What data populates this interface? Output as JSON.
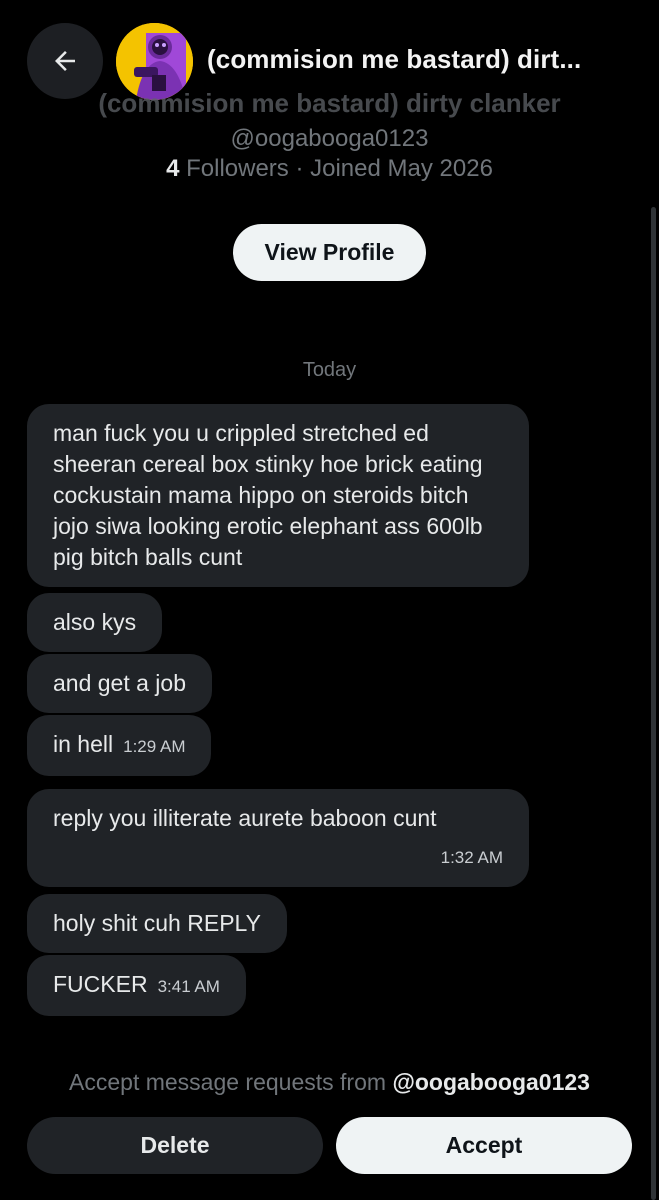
{
  "header": {
    "title": "(commision me bastard) dirt...",
    "back_icon": "arrow-left-icon"
  },
  "profile": {
    "display_name": "(commision me bastard) dirty clanker",
    "handle": "@oogabooga0123",
    "followers_count": "4",
    "followers_label": " Followers · Joined May 2026",
    "view_profile_label": "View Profile",
    "avatar": "purple-figure-avatar"
  },
  "conversation": {
    "day_label": "Today",
    "messages": [
      {
        "text": "man fuck you u crippled stretched ed sheeran cereal box stinky hoe brick eating cockustain mama hippo on steroids bitch jojo siwa looking erotic elephant ass 600lb pig bitch balls cunt",
        "time": ""
      },
      {
        "text": "also kys",
        "time": ""
      },
      {
        "text": "and get a job",
        "time": ""
      },
      {
        "text": "in hell",
        "time": "1:29 AM"
      },
      {
        "text": "reply you illiterate aurete baboon cunt",
        "time": "1:32 AM"
      },
      {
        "text": "holy shit cuh REPLY",
        "time": ""
      },
      {
        "text": "FUCKER",
        "time": "3:41 AM"
      }
    ]
  },
  "request": {
    "prefix": "Accept message requests from ",
    "handle": "@oogabooga0123",
    "delete_label": "Delete",
    "accept_label": "Accept"
  },
  "colors": {
    "background": "#000000",
    "bubble": "#202327",
    "muted_text": "#71767b",
    "light_button": "#eff3f4"
  }
}
